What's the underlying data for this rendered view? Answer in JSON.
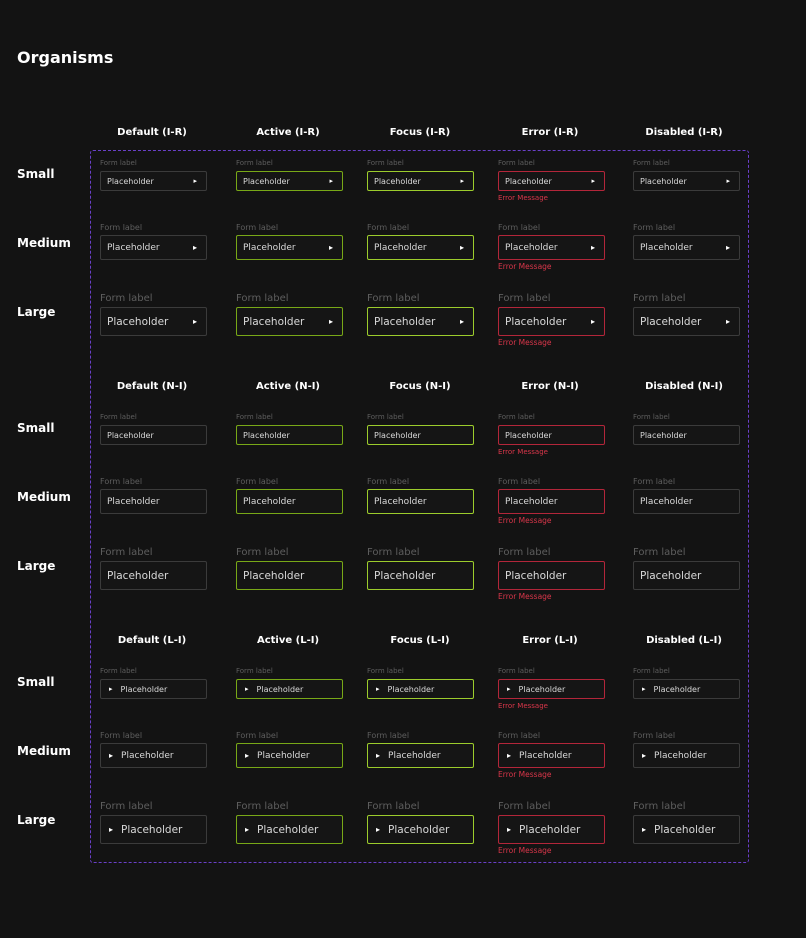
{
  "page_title": "Organisms",
  "row_labels": {
    "small": "Small",
    "medium": "Medium",
    "large": "Large"
  },
  "field": {
    "form_label": "Form label",
    "placeholder": "Placeholder",
    "error_message": "Error Message",
    "icon": "caret-right-icon"
  },
  "sections": [
    {
      "id": "ir",
      "headers": [
        "Default (I-R)",
        "Active (I-R)",
        "Focus (I-R)",
        "Error (I-R)",
        "Disabled (I-R)"
      ]
    },
    {
      "id": "ni",
      "headers": [
        "Default (N-I)",
        "Active (N-I)",
        "Focus (N-I)",
        "Error (N-I)",
        "Disabled (N-I)"
      ]
    },
    {
      "id": "li",
      "headers": [
        "Default (L-I)",
        "Active (L-I)",
        "Focus (L-I)",
        "Error (L-I)",
        "Disabled (L-I)"
      ]
    }
  ],
  "colors": {
    "background": "#131313",
    "frame_border": "#6a3fc8",
    "default_border": "#3b3b3b",
    "active_border": "#78a817",
    "focus_border": "#9ccc2c",
    "error_border": "#b3263a",
    "error_text": "#d9364a",
    "form_label_text": "#5e5e5e"
  }
}
